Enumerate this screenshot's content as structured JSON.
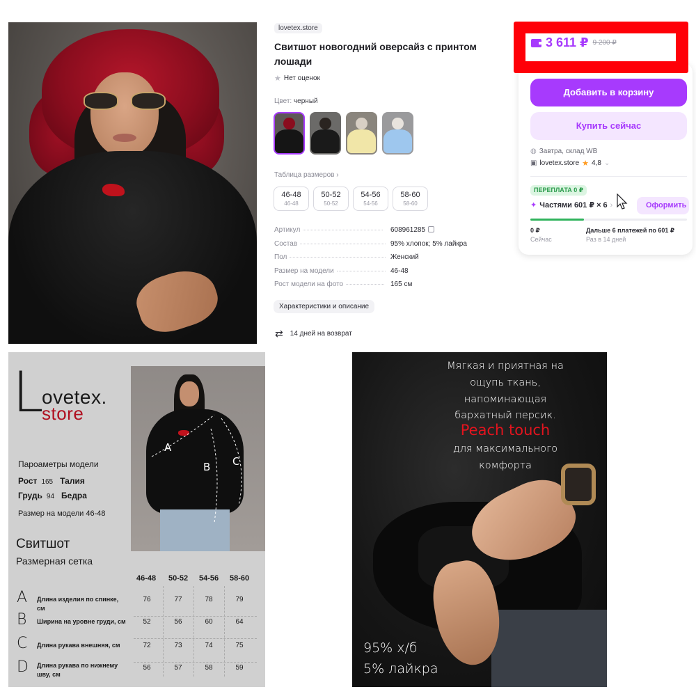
{
  "product": {
    "store_badge": "lovetex.store",
    "title": "Свитшот новогодний оверсайз с принтом лошади",
    "rating_text": "Нет оценок",
    "color_label": "Цвет:",
    "color_value": "черный",
    "size_table_link": "Таблица размеров",
    "sizes": [
      {
        "label": "46-48",
        "sub": "46-48"
      },
      {
        "label": "50-52",
        "sub": "50-52"
      },
      {
        "label": "54-56",
        "sub": "54-56"
      },
      {
        "label": "58-60",
        "sub": "58-60"
      }
    ],
    "specs": [
      {
        "key": "Артикул",
        "value": "608961285"
      },
      {
        "key": "Состав",
        "value": "95% хлопок; 5% лайкра"
      },
      {
        "key": "Пол",
        "value": "Женский"
      },
      {
        "key": "Размер на модели",
        "value": "46-48"
      },
      {
        "key": "Рост модели на фото",
        "value": "165 см"
      }
    ],
    "characteristics_button": "Характеристики и описание",
    "returns_text": "14 дней на возврат"
  },
  "price_card": {
    "price_now": "3 611 ₽",
    "price_old": "9 200 ₽",
    "add_to_cart": "Добавить в корзину",
    "buy_now": "Купить сейчас",
    "delivery": "Завтра, склад WB",
    "seller_name": "lovetex.store",
    "seller_rating": "4,8",
    "overpay_badge": "ПЕРЕПЛАТА 0 ₽",
    "parts_text": "Частями 601 ₽ × 6",
    "order_button": "Оформить",
    "progress_fraction": 0.34,
    "schedule": [
      {
        "title": "0 ₽",
        "desc": "Сейчас"
      },
      {
        "title": "Дальше 6 платежей по 601 ₽",
        "desc": "Раз в 14 дней"
      }
    ]
  },
  "size_chart": {
    "logo_l": "L",
    "logo_ovetex": "ovetex.",
    "logo_store": "store",
    "model_params_title": "Пароаметры модели",
    "model_lines": [
      {
        "k1": "Рост",
        "n1": "165",
        "k2": "Талия"
      },
      {
        "k1": "Грудь",
        "n1": "94",
        "k2": "Бедра"
      }
    ],
    "model_size": "Размер на модели 46-48",
    "sweatshirt_title": "Свитшот",
    "grid_title": "Размерная сетка",
    "measure_letters": [
      "A",
      "B",
      "C"
    ],
    "columns": [
      "46-48",
      "50-52",
      "54-56",
      "58-60"
    ],
    "rows": [
      {
        "letter": "A",
        "label": "Длина изделия по спинке, см",
        "values": [
          "76",
          "77",
          "78",
          "79"
        ]
      },
      {
        "letter": "B",
        "label": "Ширина на уровне груди, см",
        "values": [
          "52",
          "56",
          "60",
          "64"
        ]
      },
      {
        "letter": "C",
        "label": "Длина рукава внешняя, см",
        "values": [
          "72",
          "73",
          "74",
          "75"
        ]
      },
      {
        "letter": "D",
        "label": "Длина рукава по нижнему шву, см",
        "values": [
          "56",
          "57",
          "58",
          "59"
        ]
      }
    ]
  },
  "promo": {
    "lines": [
      "Мягкая и приятная на",
      "ощупь ткань,",
      "напоминающая",
      "бархатный персик."
    ],
    "accent": "Peach touch",
    "lines2": [
      "для максимального",
      "комфорта"
    ],
    "composition": [
      "95% х/б",
      "5% лайкра"
    ]
  },
  "colors": {
    "accent": "#a73afd",
    "highlight_box": "#ff0008",
    "overpay_green": "#2a9b4b",
    "brand_red": "#b01020"
  }
}
